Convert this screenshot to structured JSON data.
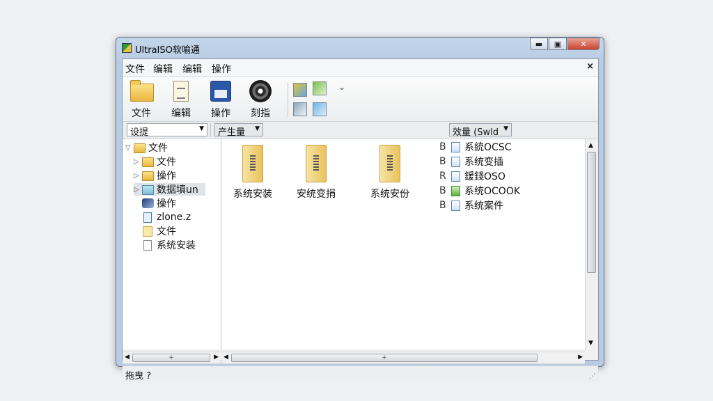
{
  "window": {
    "title": "UltraISO软喻通"
  },
  "window_controls": {
    "minimize": "▬",
    "maximize": "▣",
    "close": "✕"
  },
  "menubar": {
    "items": [
      "文件",
      "编辑",
      "编辑",
      "操作"
    ],
    "close_glyph": "×"
  },
  "toolbar": {
    "buttons": [
      {
        "label": "文件",
        "icon": "folder-icon"
      },
      {
        "label": "编辑",
        "icon": "document-icon"
      },
      {
        "label": "操作",
        "icon": "floppy-disk-icon"
      },
      {
        "label": "刻指",
        "icon": "disc-icon"
      }
    ],
    "dropdown_glyph": "⌄"
  },
  "filterbar": {
    "combo1": "设提",
    "combo2": "产生量",
    "combo3": "效量 (Swld"
  },
  "tree": {
    "items": [
      {
        "label": "文件",
        "icon": "folder-icon",
        "twisty": "▽",
        "level": 0
      },
      {
        "label": "文件",
        "icon": "folder-icon",
        "twisty": "▷",
        "level": 1
      },
      {
        "label": "操作",
        "icon": "folder-icon",
        "twisty": "▷",
        "level": 1
      },
      {
        "label": "数据填un",
        "icon": "folder-icon",
        "twisty": "▷",
        "level": 1
      },
      {
        "label": "操作",
        "icon": "disc-icon",
        "twisty": "",
        "level": 1
      },
      {
        "label": "zlone.z",
        "icon": "document-icon",
        "twisty": "",
        "level": 1
      },
      {
        "label": "文件",
        "icon": "file-icon",
        "twisty": "",
        "level": 1
      },
      {
        "label": "系统安装",
        "icon": "document-icon",
        "twisty": "",
        "level": 1
      }
    ]
  },
  "files": {
    "big_items": [
      {
        "label": "系统安装"
      },
      {
        "label": "安统变捐"
      },
      {
        "label": "系统安份"
      }
    ],
    "list_items": [
      {
        "prefix": "B",
        "label": "系統OCSC"
      },
      {
        "prefix": "B",
        "label": "系统变插"
      },
      {
        "prefix": "R",
        "label": "鍰錢OSO"
      },
      {
        "prefix": "B",
        "label": "系统OCOOK"
      },
      {
        "prefix": "B",
        "label": "系统案件"
      }
    ]
  },
  "scroll": {
    "up": "▲",
    "down": "▼",
    "left": "◀",
    "right": "▶",
    "thumb_grip": "+",
    "vgrip": "≡"
  },
  "status": {
    "text": "拖曳 ?",
    "grip": "⋰"
  }
}
